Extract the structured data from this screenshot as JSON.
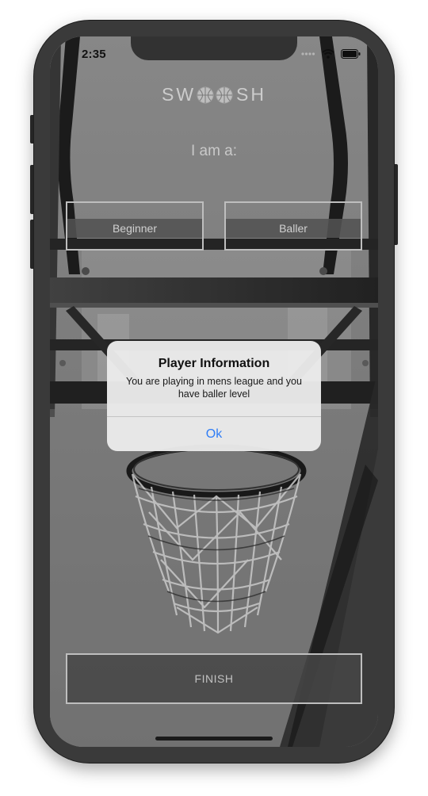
{
  "status_bar": {
    "time": "2:35"
  },
  "app": {
    "logo_part1": "SW",
    "logo_part2": "SH",
    "prompt": "I am a:",
    "choices": [
      {
        "label": "Beginner"
      },
      {
        "label": "Baller"
      }
    ],
    "finish_label": "FINISH"
  },
  "alert": {
    "title": "Player Information",
    "message": "You are playing in mens league and you have baller level",
    "ok_label": "Ok",
    "ok_color": "#2f7df6"
  },
  "icons": [
    "basketball-icon",
    "signal-icon",
    "wifi-icon",
    "battery-icon"
  ]
}
